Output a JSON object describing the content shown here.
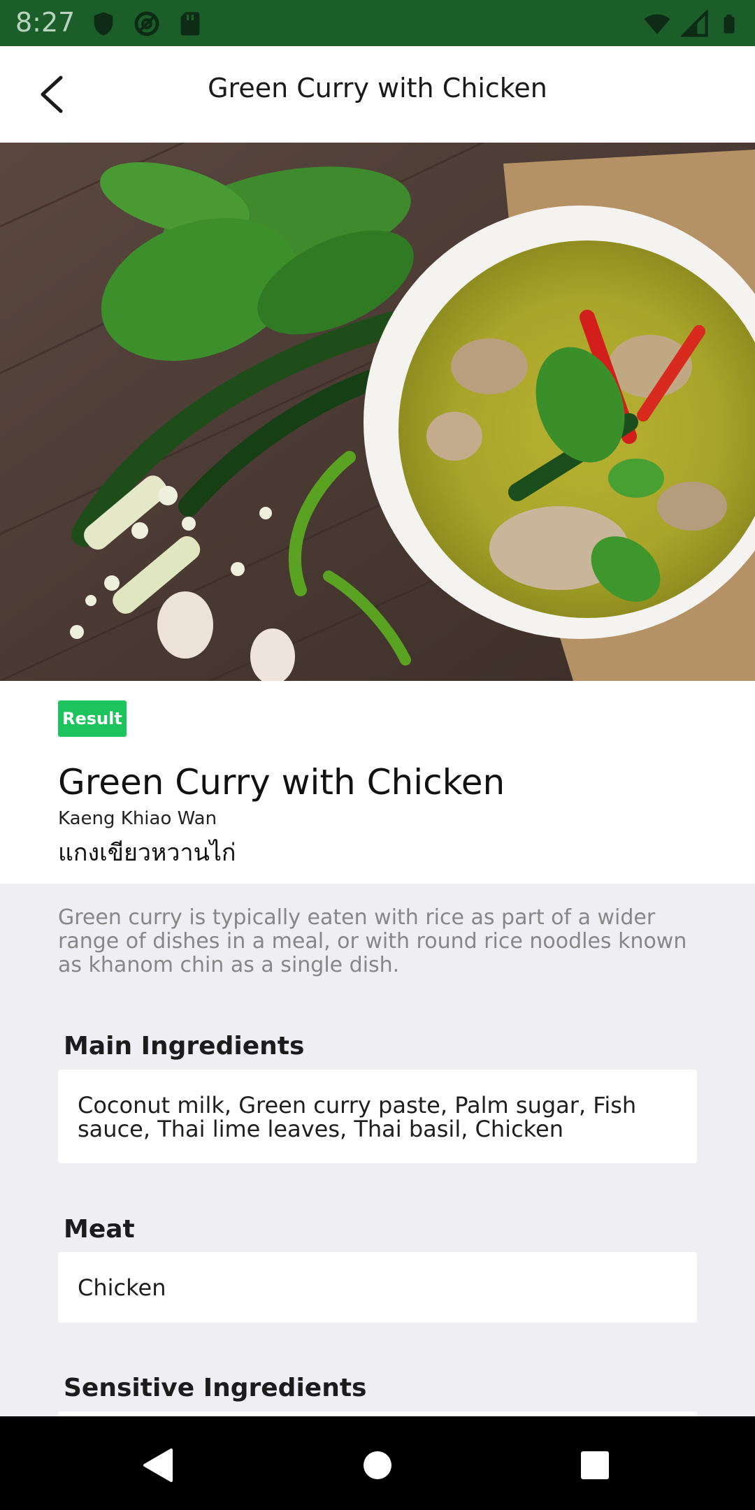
{
  "status_bar": {
    "time": "8:27",
    "background": "#1b5e2a",
    "left_icons": [
      "shield-icon",
      "at-sign-icon",
      "sd-card-icon"
    ],
    "right_icons": [
      "wifi-icon",
      "signal-icon",
      "battery-icon"
    ]
  },
  "app_bar": {
    "title": "Green Curry with Chicken",
    "back_icon": "chevron-left-icon"
  },
  "hero_image": {
    "subject": "green-curry-photo"
  },
  "header": {
    "badge": "Result",
    "badge_color": "#1dc45d",
    "title": "Green Curry with Chicken",
    "romanized": "Kaeng Khiao Wan",
    "thai": "แกงเขียวหวานไก่"
  },
  "description": "Green curry is typically eaten with rice as part of a wider range of dishes in a meal, or with round rice noodles known as khanom chin as a single dish.",
  "sections": {
    "main_ingredients": {
      "title": "Main Ingredients",
      "value": "Coconut milk, Green curry paste, Palm sugar, Fish sauce, Thai lime leaves, Thai basil, Chicken"
    },
    "meat": {
      "title": "Meat",
      "value": "Chicken"
    },
    "sensitive_ingredients": {
      "title": "Sensitive Ingredients",
      "value": ""
    }
  },
  "nav_bar": {
    "buttons": [
      "back-triangle-icon",
      "home-circle-icon",
      "recents-square-icon"
    ]
  }
}
